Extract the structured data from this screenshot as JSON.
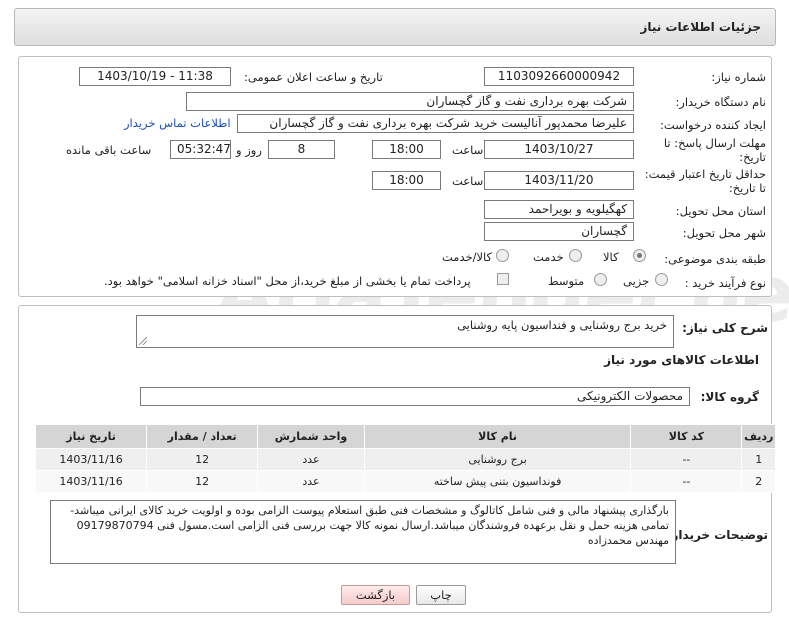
{
  "header": {
    "title": "جزئیات اطلاعات نیاز"
  },
  "watermark": "AriaTender.neT",
  "form": {
    "need_number_label": "شماره نیاز:",
    "need_number": "1103092660000942",
    "announce_label": "تاریخ و ساعت اعلان عمومی:",
    "announce_value": "1403/10/19 - 11:38",
    "buyer_org_label": "نام دستگاه خریدار:",
    "buyer_org": "شرکت بهره برداری نفت و گاز گچساران",
    "requester_label": "ایجاد کننده درخواست:",
    "requester": "علیرضا محمدپور آنالیست خرید شرکت بهره برداری نفت و گاز گچساران",
    "contact_link": "اطلاعات تماس خریدار",
    "reply_deadline_label": "مهلت ارسال پاسخ: تا تاریخ:",
    "reply_date": "1403/10/27",
    "time_label": "ساعت",
    "reply_time": "18:00",
    "days_value": "8",
    "days_label": "روز و",
    "remaining_time": "05:32:47",
    "remaining_label": "ساعت باقی مانده",
    "validity_label": "حداقل تاریخ اعتبار قیمت: تا تاریخ:",
    "validity_date": "1403/11/20",
    "validity_time": "18:00",
    "province_label": "استان محل تحویل:",
    "province": "کهگیلویه و بویراحمد",
    "city_label": "شهر محل تحویل:",
    "city": "گچساران",
    "category_label": "طبقه بندی موضوعی:",
    "category_options": [
      "کالا",
      "خدمت",
      "کالا/خدمت"
    ],
    "category_selected": "کالا",
    "process_label": "نوع فرآیند خرید :",
    "process_options": [
      "جزیی",
      "متوسط"
    ],
    "payment_note": "پرداخت تمام یا بخشی از مبلغ خرید،از محل \"اسناد خزانه اسلامی\" خواهد بود."
  },
  "summary": {
    "desc_label": "شرح کلی نیاز:",
    "desc_value": "خرید برج روشنایی و فنداسیون پایه روشنایی",
    "items_title": "اطلاعات کالاهای مورد نیاز",
    "group_label": "گروه کالا:",
    "group_value": "محصولات الکترونیکی"
  },
  "table": {
    "headers": [
      "ردیف",
      "کد کالا",
      "نام کالا",
      "واحد شمارش",
      "تعداد / مقدار",
      "تاریخ نیاز"
    ],
    "rows": [
      [
        "1",
        "--",
        "برج روشنایی",
        "عدد",
        "12",
        "1403/11/16"
      ],
      [
        "2",
        "--",
        "فونداسیون بتنی پیش ساخته",
        "عدد",
        "12",
        "1403/11/16"
      ]
    ]
  },
  "notes": {
    "label": "توضیحات خریدار:",
    "text": "بارگذاری پیشنهاد مالی و فنی شامل کاتالوگ و مشخصات فنی طبق استعلام پیوست الزامی بوده و اولویت خرید کالای ایرانی میباشد-تمامی هزینه حمل و نقل برعهده فروشندگان میباشد.ارسال نمونه کالا جهت بررسی فنی الزامی است.مسول فنی 09179870794 مهندس محمدزاده"
  },
  "buttons": {
    "print": "چاپ",
    "back": "بازگشت"
  },
  "colors": {
    "link": "#1a4fb8",
    "header_bg": "#e6e6e6",
    "table_header": "#d5d5d5"
  }
}
